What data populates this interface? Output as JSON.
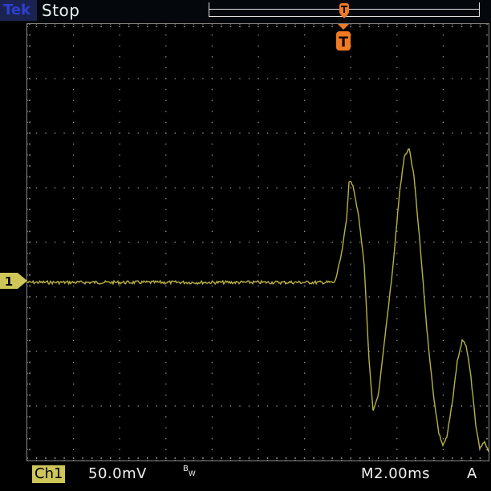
{
  "header": {
    "brand": "Tek",
    "run_status": "Stop"
  },
  "trigger": {
    "marker_label": "T",
    "marker_color": "#f07a22"
  },
  "channel": {
    "marker_label": "1",
    "label": "Ch1",
    "scale": "50.0mV",
    "bandwidth_limit_icon": "bw-limit-icon",
    "color": "#cfc65a"
  },
  "timebase": {
    "scale": "M2.00ms",
    "trigger_source": "A"
  },
  "colors": {
    "trace": "#b9b243",
    "graticule": "#9a9a9a",
    "text": "#f2f2f2",
    "brand_bg": "#1b2450",
    "brand_text": "#2e3fd0"
  }
}
